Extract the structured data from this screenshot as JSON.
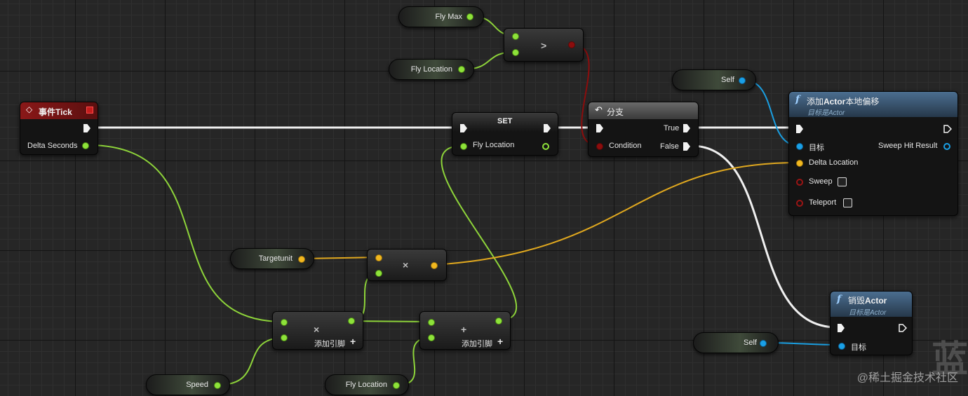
{
  "nodes": {
    "event_tick": {
      "title": "事件Tick",
      "pin_delta": "Delta Seconds",
      "color": "#7a1414"
    },
    "fly_max": {
      "label": "Fly Max"
    },
    "fly_location_top": {
      "label": "Fly Location"
    },
    "greater": {
      "op": ">"
    },
    "set": {
      "title": "SET",
      "pin_fly_location": "Fly Location"
    },
    "branch": {
      "title": "分支",
      "pin_true": "True",
      "pin_condition": "Condition",
      "pin_false": "False"
    },
    "self_top": {
      "label": "Self"
    },
    "add_offset": {
      "title_prefix": "添加",
      "title_bold": "Actor",
      "title_suffix": "本地偏移",
      "subtitle": "目标是Actor",
      "pin_target": "目标",
      "pin_sweep_hit": "Sweep Hit Result",
      "pin_delta_location": "Delta Location",
      "pin_sweep": "Sweep",
      "pin_teleport": "Teleport"
    },
    "targetunit": {
      "label": "Targetunit"
    },
    "mult_top": {
      "op": "×"
    },
    "mult_bottom": {
      "op": "×",
      "add_pin": "添加引脚",
      "plus": "+"
    },
    "add_bottom": {
      "op": "+",
      "add_pin": "添加引脚",
      "plus": "+"
    },
    "destroy": {
      "title_prefix": "销毁",
      "title_bold": "Actor",
      "subtitle": "目标是Actor",
      "pin_target": "目标"
    },
    "self_bottom": {
      "label": "Self"
    },
    "speed": {
      "label": "Speed"
    },
    "fly_location_bottom": {
      "label": "Fly Location"
    }
  },
  "watermark": {
    "text": "@稀土掘金技术社区",
    "glyph": "蓝"
  },
  "colors": {
    "exec_wire": "#f0f0f0",
    "float_wire": "#8ed43a",
    "vector_wire": "#e0a81f",
    "object_wire": "#1a9ee0",
    "bool_wire": "#8c0d0d",
    "function_header": "#3a5a78",
    "branch_header": "#5a5a5a"
  },
  "icons": [
    "event-diamond-icon",
    "delegate-square-icon",
    "branch-arrow-icon",
    "function-f-icon",
    "exec-arrow-icon",
    "checkbox-icon"
  ]
}
